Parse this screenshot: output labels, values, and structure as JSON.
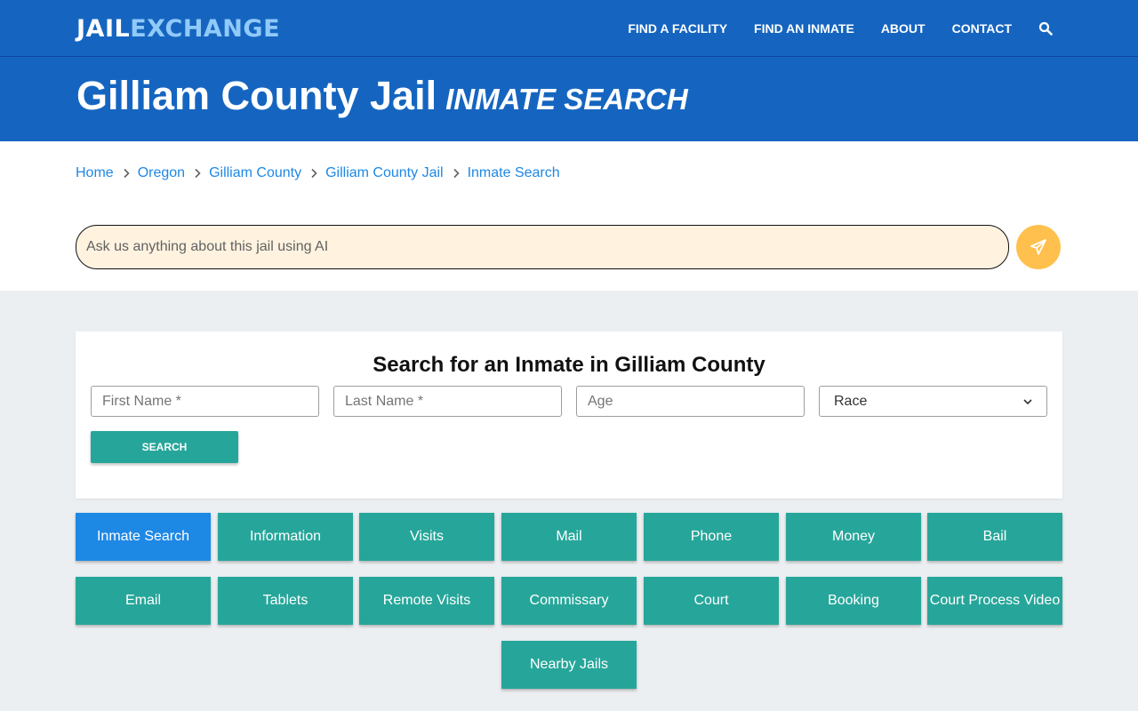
{
  "header": {
    "logo_part1": "JAIL",
    "logo_part2": "EXCHANGE",
    "nav": [
      "FIND A FACILITY",
      "FIND AN INMATE",
      "ABOUT",
      "CONTACT"
    ],
    "search_icon": "search-icon"
  },
  "title": {
    "main": "Gilliam County Jail",
    "sub": "INMATE SEARCH"
  },
  "breadcrumb": [
    "Home",
    "Oregon",
    "Gilliam County",
    "Gilliam County Jail",
    "Inmate Search"
  ],
  "ai": {
    "placeholder": "Ask us anything about this jail using AI",
    "send_icon": "paper-plane-icon"
  },
  "search_form": {
    "title": "Search for an Inmate in Gilliam County",
    "first_name_placeholder": "First Name *",
    "last_name_placeholder": "Last Name *",
    "age_placeholder": "Age",
    "race_selected": "Race",
    "button": "SEARCH"
  },
  "tiles": [
    "Inmate Search",
    "Information",
    "Visits",
    "Mail",
    "Phone",
    "Money",
    "Bail",
    "Email",
    "Tablets",
    "Remote Visits",
    "Commissary",
    "Court",
    "Booking",
    "Court Process Video",
    "Nearby Jails"
  ],
  "active_tile": "Inmate Search",
  "colors": {
    "brand_blue": "#1565c0",
    "accent_blue": "#1e88e5",
    "teal": "#26a69a",
    "ai_input_bg": "#fff3e0",
    "send_button": "#ffc04d"
  }
}
